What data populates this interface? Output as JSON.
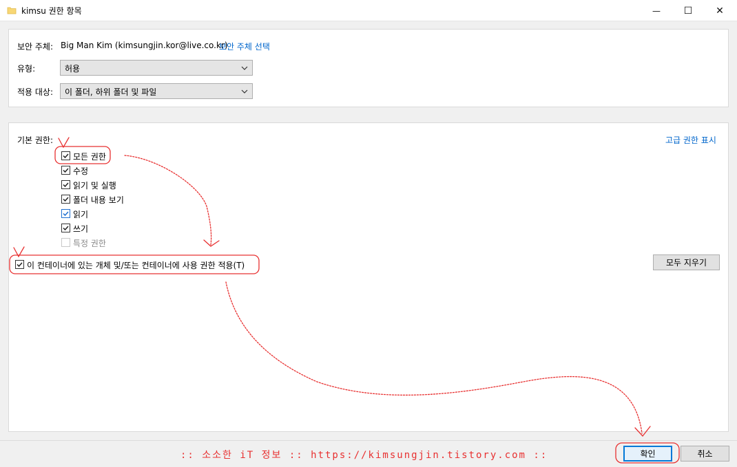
{
  "window": {
    "title": "kimsu 권한 항목",
    "minimize_glyph": "—",
    "maximize_glyph": "☐",
    "close_glyph": "✕"
  },
  "principal": {
    "label": "보안 주체:",
    "value": "Big Man Kim (kimsungjin.kor@live.co.kr)",
    "select_link": "보안 주체 선택"
  },
  "type": {
    "label": "유형:",
    "value": "허용"
  },
  "applies_to": {
    "label": "적용 대상:",
    "value": "이 폴더, 하위 폴더 및 파일"
  },
  "basic_permissions": {
    "label": "기본 권한:",
    "advanced_link": "고급 권한 표시",
    "items": [
      {
        "label": "모든 권한",
        "checked": true
      },
      {
        "label": "수정",
        "checked": true
      },
      {
        "label": "읽기 및 실행",
        "checked": true
      },
      {
        "label": "폴더 내용 보기",
        "checked": true
      },
      {
        "label": "읽기",
        "checked": true
      },
      {
        "label": "쓰기",
        "checked": true
      },
      {
        "label": "특정 권한",
        "checked": false
      }
    ],
    "clear_all_button": "모두 지우기"
  },
  "apply_to_container": {
    "label": "이 컨테이너에 있는 개체 및/또는 컨테이너에 사용 권한 적용(T)",
    "checked": true
  },
  "footer": {
    "watermark": ":: 소소한 iT 정보 :: https://kimsungjin.tistory.com ::",
    "ok_button": "확인",
    "cancel_button": "취소"
  },
  "colors": {
    "link": "#0066cc",
    "annotation": "#e83030",
    "primary_button_border": "#0078d7"
  }
}
